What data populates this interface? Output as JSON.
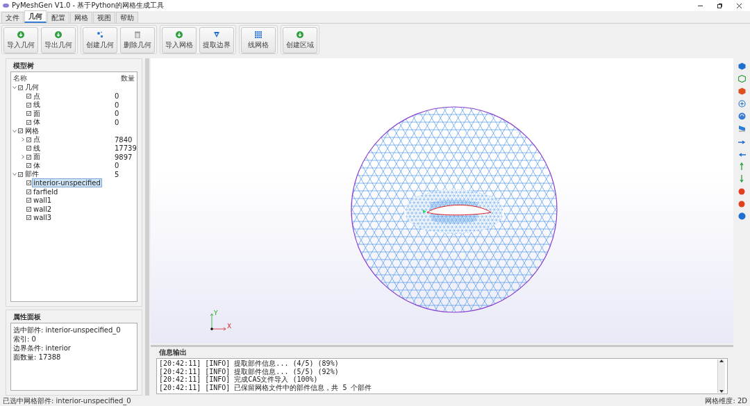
{
  "window": {
    "title": "PyMeshGen V1.0 - 基于Python的网格生成工具"
  },
  "menu_tabs": [
    {
      "label": "文件",
      "selected": false
    },
    {
      "label": "几何",
      "selected": true
    },
    {
      "label": "配置",
      "selected": false
    },
    {
      "label": "网格",
      "selected": false
    },
    {
      "label": "视图",
      "selected": false
    },
    {
      "label": "帮助",
      "selected": false
    }
  ],
  "toolbar_groups": [
    {
      "buttons": [
        {
          "label": "导入几何",
          "kind": "import"
        },
        {
          "label": "导出几何",
          "kind": "import"
        }
      ]
    },
    {
      "buttons": [
        {
          "label": "创建几何",
          "kind": "create"
        },
        {
          "label": "删除几何",
          "kind": "delete"
        }
      ]
    },
    {
      "buttons": [
        {
          "label": "导入网格",
          "kind": "import"
        },
        {
          "label": "提取边界",
          "kind": "filter"
        }
      ]
    },
    {
      "buttons": [
        {
          "label": "线网格",
          "kind": "grid"
        }
      ]
    },
    {
      "buttons": [
        {
          "label": "创建区域",
          "kind": "import"
        }
      ]
    }
  ],
  "model_tree": {
    "title": "模型树",
    "columns": [
      "名称",
      "数量"
    ],
    "items": [
      {
        "label": "几何",
        "checked": true,
        "expanded": true,
        "selected": false,
        "children": [
          {
            "label": "点",
            "count": "0",
            "checked": true,
            "selected": false
          },
          {
            "label": "线",
            "count": "0",
            "checked": true,
            "selected": false
          },
          {
            "label": "面",
            "count": "0",
            "checked": true,
            "selected": false
          },
          {
            "label": "体",
            "count": "0",
            "checked": true,
            "selected": false
          }
        ]
      },
      {
        "label": "网格",
        "checked": true,
        "expanded": true,
        "selected": false,
        "children": [
          {
            "label": "点",
            "count": "7840",
            "checked": true,
            "expanded": false,
            "selected": false
          },
          {
            "label": "线",
            "count": "17739",
            "checked": true,
            "selected": false
          },
          {
            "label": "面",
            "count": "9897",
            "checked": true,
            "expanded": false,
            "selected": false
          },
          {
            "label": "体",
            "count": "0",
            "checked": true,
            "selected": false
          }
        ]
      },
      {
        "label": "部件",
        "count": "5",
        "checked": true,
        "expanded": true,
        "selected": false,
        "children": [
          {
            "label": "interior-unspecified",
            "checked": true,
            "selected": true
          },
          {
            "label": "farfield",
            "checked": true,
            "selected": false
          },
          {
            "label": "wall1",
            "checked": true,
            "selected": false
          },
          {
            "label": "wall2",
            "checked": true,
            "selected": false
          },
          {
            "label": "wall3",
            "checked": true,
            "selected": false
          }
        ]
      }
    ]
  },
  "properties": {
    "title": "属性面板",
    "lines": [
      "选中部件: interior-unspecified_0",
      "索引: 0",
      "边界条件: interior",
      "面数量: 17388"
    ]
  },
  "log": {
    "title": "信息输出",
    "lines": [
      "[20:42:11] [INFO] 提取部件信息... (4/5) (89%)",
      "[20:42:11] [INFO] 提取部件信息... (5/5) (92%)",
      "[20:42:11] [INFO] 完成CAS文件导入 (100%)",
      "[20:42:11] [INFO] 已保留网格文件中的部件信息，共 5 个部件"
    ]
  },
  "status_bar": {
    "left": "已选中网格部件: interior-unspecified_0",
    "right": "网格维度: 2D"
  },
  "axes": {
    "x": "X",
    "y": "Y"
  }
}
